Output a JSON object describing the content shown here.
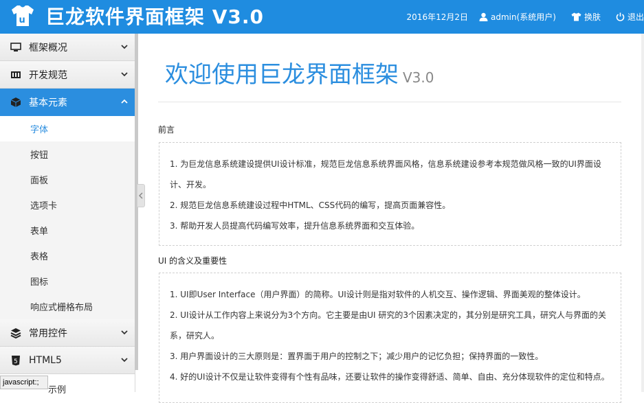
{
  "header": {
    "title": "巨龙软件界面框架 V3.0",
    "date": "2016年12月2日",
    "user": "admin(系统用户)",
    "skin": "换肤",
    "logout": "退出",
    "color": "#1f8ce0"
  },
  "sidebar": {
    "groups_top": [
      {
        "label": "框架概况",
        "icon": "monitor-icon"
      },
      {
        "label": "开发规范",
        "icon": "piano-icon"
      },
      {
        "label": "基本元素",
        "icon": "cube-icon"
      }
    ],
    "sub_items": [
      {
        "label": "字体"
      },
      {
        "label": "按钮"
      },
      {
        "label": "面板"
      },
      {
        "label": "选项卡"
      },
      {
        "label": "表单"
      },
      {
        "label": "表格"
      },
      {
        "label": "图标"
      },
      {
        "label": "响应式栅格布局"
      }
    ],
    "groups_bottom": [
      {
        "label": "常用控件",
        "icon": "layers-icon"
      },
      {
        "label": "HTML5",
        "icon": "html5-icon"
      }
    ],
    "peek_label": "示例"
  },
  "content": {
    "title": "欢迎使用巨龙界面框架",
    "version": "V3.0",
    "section1": {
      "title": "前言",
      "lines": [
        "1. 为巨龙信息系统建设提供UI设计标准，规范巨龙信息系统界面风格，信息系统建设参考本规范做风格一致的UI界面设",
        "计、开发。",
        "2. 规范巨龙信息系统建设过程中HTML、CSS代码的编写，提高页面兼容性。",
        "3. 帮助开发人员提高代码编写效率，提升信息系统界面和交互体验。"
      ]
    },
    "section2": {
      "title": "UI 的含义及重要性",
      "lines": [
        "1. UI即User Interface（用户界面）的简称。UI设计则是指对软件的人机交互、操作逻辑、界面美观的整体设计。",
        "2. UI设计从工作内容上来说分为3个方向。它主要是由UI 研究的3个因素决定的，其分别是研究工具，研究人与界面的关",
        "系，研究人。",
        "3. 用户界面设计的三大原则是：置界面于用户的控制之下；减少用户的记忆负担；保持界面的一致性。",
        "4. 好的UI设计不仅是让软件变得有个性有品味，还要让软件的操作变得舒适、简单、自由、充分体现软件的定位和特点。"
      ]
    }
  },
  "status": {
    "text": "javascript:;"
  }
}
